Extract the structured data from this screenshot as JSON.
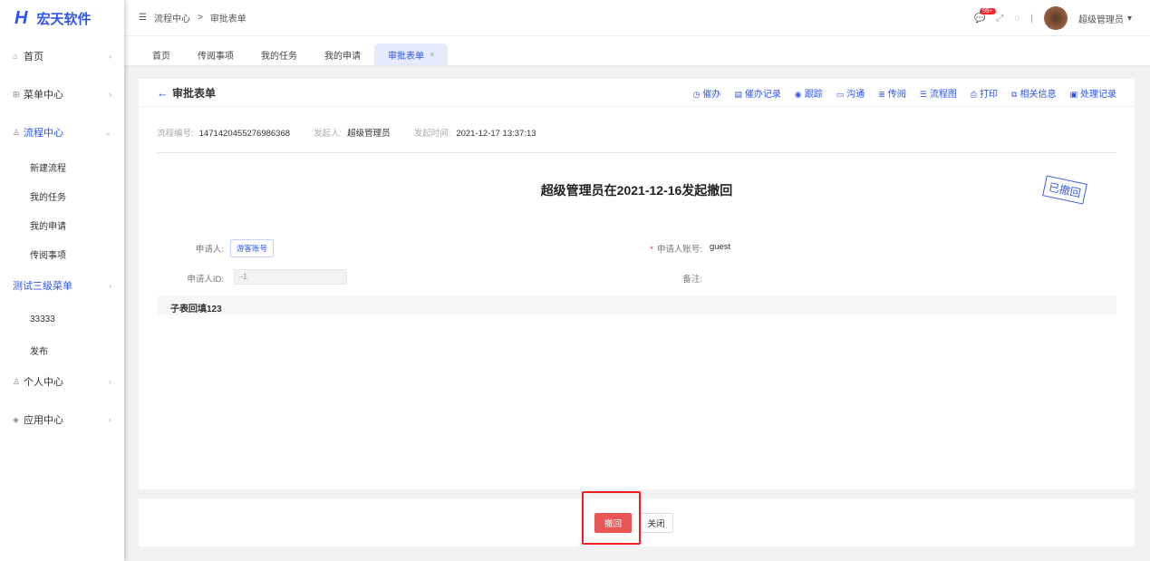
{
  "app": {
    "logo_mark": "H",
    "name": "宏天软件"
  },
  "sidebar": {
    "items": [
      {
        "label": "首页",
        "icon": "home-icon"
      },
      {
        "label": "菜单中心",
        "icon": "grid-icon"
      },
      {
        "label": "流程中心",
        "icon": "flow-icon"
      },
      {
        "label": "新建流程"
      },
      {
        "label": "我的任务"
      },
      {
        "label": "我的申请"
      },
      {
        "label": "传阅事项"
      },
      {
        "label": "测试三级菜单"
      },
      {
        "label": "33333"
      },
      {
        "label": "发布"
      },
      {
        "label": "个人中心",
        "icon": "user-icon"
      },
      {
        "label": "应用中心",
        "icon": "app-icon"
      }
    ]
  },
  "header": {
    "breadcrumb": [
      "流程中心",
      "审批表单"
    ],
    "separator": ">",
    "badge": "99+",
    "user": "超级管理员"
  },
  "tabs": [
    {
      "label": "首页"
    },
    {
      "label": "传阅事项"
    },
    {
      "label": "我的任务"
    },
    {
      "label": "我的申请"
    },
    {
      "label": "审批表单",
      "close": "×"
    }
  ],
  "card": {
    "title": "审批表单",
    "actions": [
      {
        "label": "催办",
        "icon": "clock-icon"
      },
      {
        "label": "催办记录",
        "icon": "record-icon"
      },
      {
        "label": "跟踪",
        "icon": "track-icon"
      },
      {
        "label": "沟通",
        "icon": "chat-icon"
      },
      {
        "label": "传阅",
        "icon": "forward-icon"
      },
      {
        "label": "流程图",
        "icon": "flowchart-icon"
      },
      {
        "label": "打印",
        "icon": "print-icon"
      },
      {
        "label": "相关信息",
        "icon": "related-icon"
      },
      {
        "label": "处理记录",
        "icon": "history-icon"
      }
    ],
    "meta": {
      "flow_no_label": "流程编号:",
      "flow_no": "1471420455276986368",
      "creator_label": "发起人:",
      "creator": "超级管理员",
      "time_label": "发起时间:",
      "time": "2021-12-17 13:37:13"
    }
  },
  "form": {
    "title": "超级管理员在2021-12-16发起撤回",
    "stamp": "已撤回",
    "applicant_label": "申请人:",
    "applicant": "游客账号",
    "account_label": "申请人账号:",
    "account_required": "*",
    "account": "guest",
    "id_label": "申请人ID:",
    "id_value": "-1",
    "remark_label": "备注:",
    "subtable": "子表回填123"
  },
  "footer": {
    "revoke": "撤回",
    "close": "关闭"
  },
  "colors": {
    "accent": "#2f54eb",
    "danger": "#e95656"
  }
}
